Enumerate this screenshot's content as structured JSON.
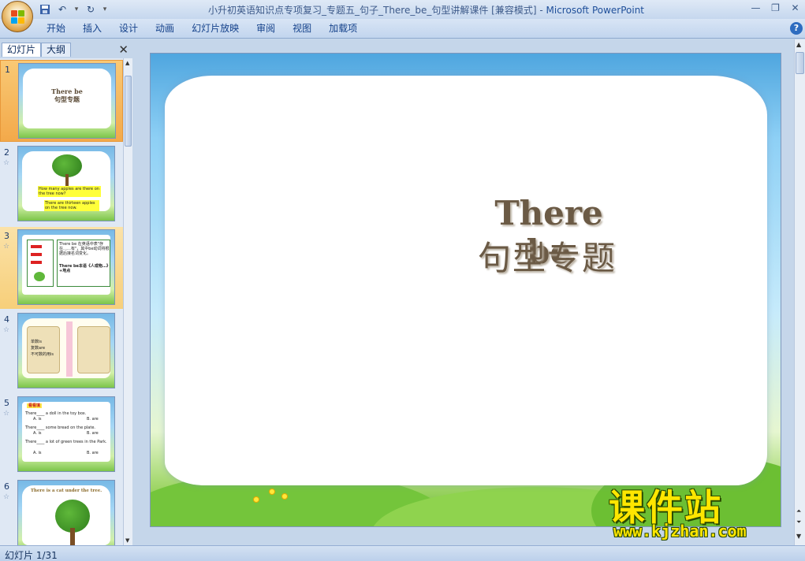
{
  "window": {
    "title": "小升初英语知识点专项复习_专题五_句子_There_be_句型讲解课件 [兼容模式]",
    "app_name": "Microsoft PowerPoint",
    "separator": " - "
  },
  "ribbon": {
    "tabs": [
      "开始",
      "插入",
      "设计",
      "动画",
      "幻灯片放映",
      "审阅",
      "视图",
      "加载项"
    ]
  },
  "left_pane": {
    "tabs": [
      "幻灯片",
      "大纲"
    ],
    "slides": [
      {
        "num": "1",
        "title": "There be",
        "subtitle": "句型专题"
      },
      {
        "num": "2",
        "q": "How many apples are there on the tree now?",
        "a": "There are thirteen apples on the tree now."
      },
      {
        "num": "3",
        "line1": "There be 在英语中表\"存在……有\"，其中be动词将根据后接名词变化。",
        "line2": "There be本语《人或物…》+地点"
      },
      {
        "num": "4",
        "l1": "单数is",
        "l2": "复数are",
        "l3": "不可数的用is"
      },
      {
        "num": "5",
        "header": "看看填",
        "q1": "There____ a doll in the toy box.",
        "q1a": "A. is",
        "q1b": "B. are",
        "q2": "There____ some bread on the plate.",
        "q2a": "A. is",
        "q2b": "B. are",
        "q3": "There____ a lot of green trees in the Park.",
        "q3a": "A. is",
        "q3b": "B. are"
      },
      {
        "num": "6",
        "title": "There is a cat under the tree."
      }
    ]
  },
  "slide": {
    "title": "There be",
    "subtitle": "句型专题"
  },
  "watermark": {
    "name": "课件站",
    "url": "www.kjzhan.com"
  },
  "status": {
    "slide_info": "幻灯片 1/31"
  },
  "colors": {
    "title_text": "#6b5a45",
    "selected_thumb": "#f3a94a",
    "watermark": "#ffe600"
  }
}
